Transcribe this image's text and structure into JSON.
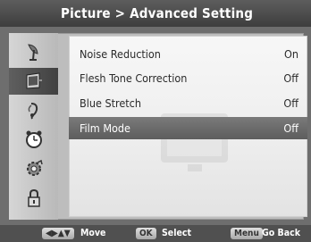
{
  "header": {
    "title": "Picture > Advanced Setting"
  },
  "sidebar": {
    "items": [
      {
        "icon": "antenna-icon",
        "active": false
      },
      {
        "icon": "picture-icon",
        "active": true
      },
      {
        "icon": "sound-icon",
        "active": false
      },
      {
        "icon": "clock-icon",
        "active": false
      },
      {
        "icon": "setup-icon",
        "active": false
      },
      {
        "icon": "lock-icon",
        "active": false
      }
    ]
  },
  "menu": {
    "rows": [
      {
        "label": "Noise Reduction",
        "value": "On"
      },
      {
        "label": "Flesh Tone Correction",
        "value": "Off"
      },
      {
        "label": "Blue Stretch",
        "value": "Off"
      },
      {
        "label": "Film Mode",
        "value": "Off",
        "selected": true
      }
    ]
  },
  "footer": {
    "move_key": "◀▶▲▼",
    "move_label": "Move",
    "select_key": "OK",
    "select_label": "Select",
    "back_key": "Menu",
    "back_label": "Go Back"
  },
  "colors": {
    "selection": "#666666",
    "background": "#6e6e6e"
  }
}
